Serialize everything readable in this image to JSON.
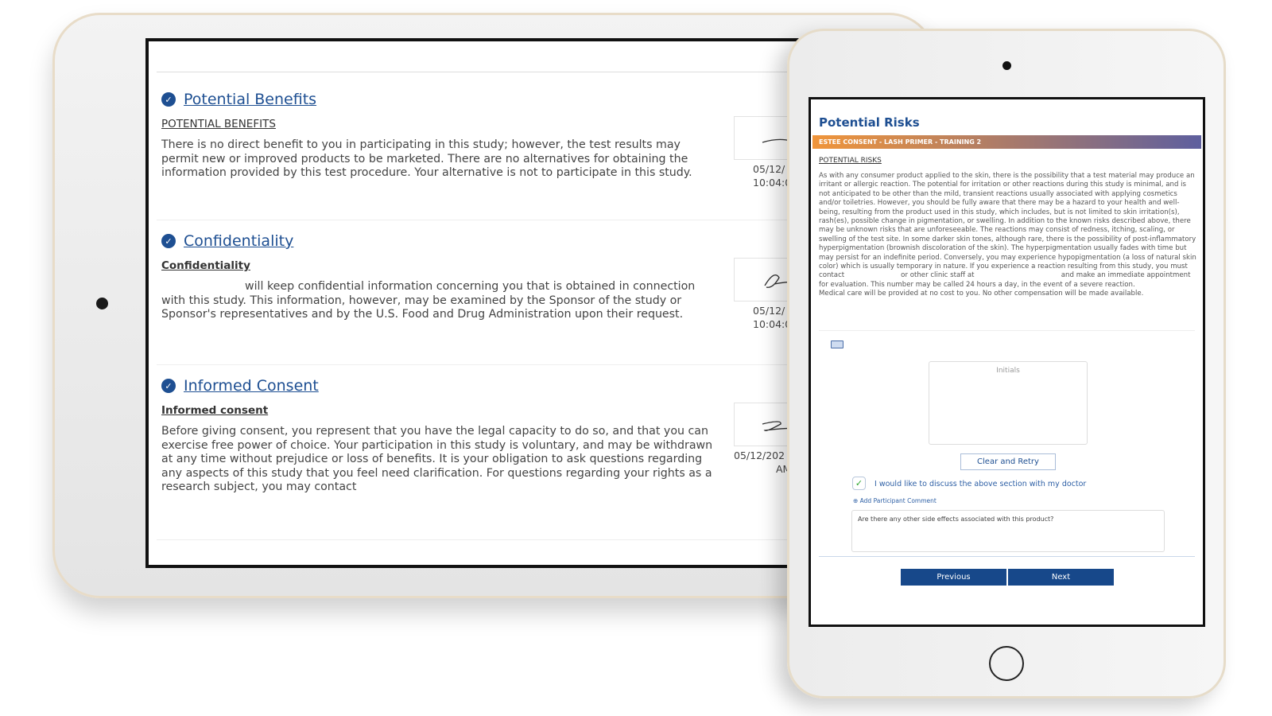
{
  "left_tablet": {
    "sections": [
      {
        "title": "Potential Benefits",
        "subtitle": "POTENTIAL BENEFITS",
        "text": "There is no direct benefit to you in participating in this study; however, the test results may permit new or improved products to be marketed. There are no alternatives for obtaining the information provided by this test procedure. Your alternative is not to participate in this study.",
        "sig_date": "05/12/",
        "sig_time": "10:04:0"
      },
      {
        "title": "Confidentiality",
        "subtitle": "Confidentiality",
        "text": "will keep confidential information concerning you that is obtained in connection with this study. This information, however, may be examined by the Sponsor of the study or Sponsor's representatives and by the U.S. Food and Drug Administration upon their request.",
        "sig_date": "05/12/",
        "sig_time": "10:04:0"
      },
      {
        "title": "Informed Consent",
        "subtitle": "Informed consent",
        "text": "Before giving consent, you represent that you have the legal capacity to do so, and that you can exercise free power of choice. Your participation in this study is voluntary, and may be withdrawn at any time without prejudice or loss of benefits. It is your obligation to ask questions regarding any aspects of this study that you feel need clarification. For questions regarding your rights as a research subject, you may contact",
        "sig_date": "05/12/202",
        "sig_time": "AM"
      }
    ]
  },
  "right_tablet": {
    "title": "Potential Risks",
    "band": "ESTEE CONSENT - LASH PRIMER - TRAINING 2",
    "subtitle": "POTENTIAL RISKS",
    "text_1": "As with any consumer product applied to the skin, there is the possibility that a test material may produce an irritant or allergic reaction. The potential for irritation or other reactions during this study is minimal, and is not anticipated to be other than the mild, transient reactions usually associated with applying cosmetics and/or toiletries. However, you should be fully aware that there may be a hazard to your health and well-being, resulting from the product used in this study, which includes, but is not limited to skin irritation(s), rash(es), possible change in pigmentation, or swelling. In addition to the known risks described above, there may be unknown risks that are unforeseeable. The reactions may consist of redness, itching, scaling, or swelling of the test site. In some darker skin tones, although rare, there is the possibility of post-inflammatory hyperpigmentation (brownish discoloration of the skin). The hyperpigmentation usually fades with time but may persist for an indefinite period. Conversely, you may experience hypopigmentation (a loss of natural skin color) which is usually temporary in nature. If you experience a reaction resulting from this study, you must contact                          or other clinic staff at                                        and make an immediate appointment for evaluation. This number may be called 24 hours a day, in the event of a severe reaction.",
    "text_2": "Medical care will be provided at no cost to you. No other compensation will be made available.",
    "initials_label": "Initials",
    "clear_label": "Clear and Retry",
    "discuss_label": "I would like to discuss the above section with my doctor",
    "discuss_checked": true,
    "add_comment_label": "Add Participant Comment",
    "comment_value": "Are there any other side effects associated with this product?",
    "previous_label": "Previous",
    "next_label": "Next"
  },
  "colors": {
    "accent": "#1e4f92",
    "button": "#17488a",
    "check": "#2aa52a",
    "band_start": "#f0953a",
    "band_end": "#5e5f9e"
  }
}
